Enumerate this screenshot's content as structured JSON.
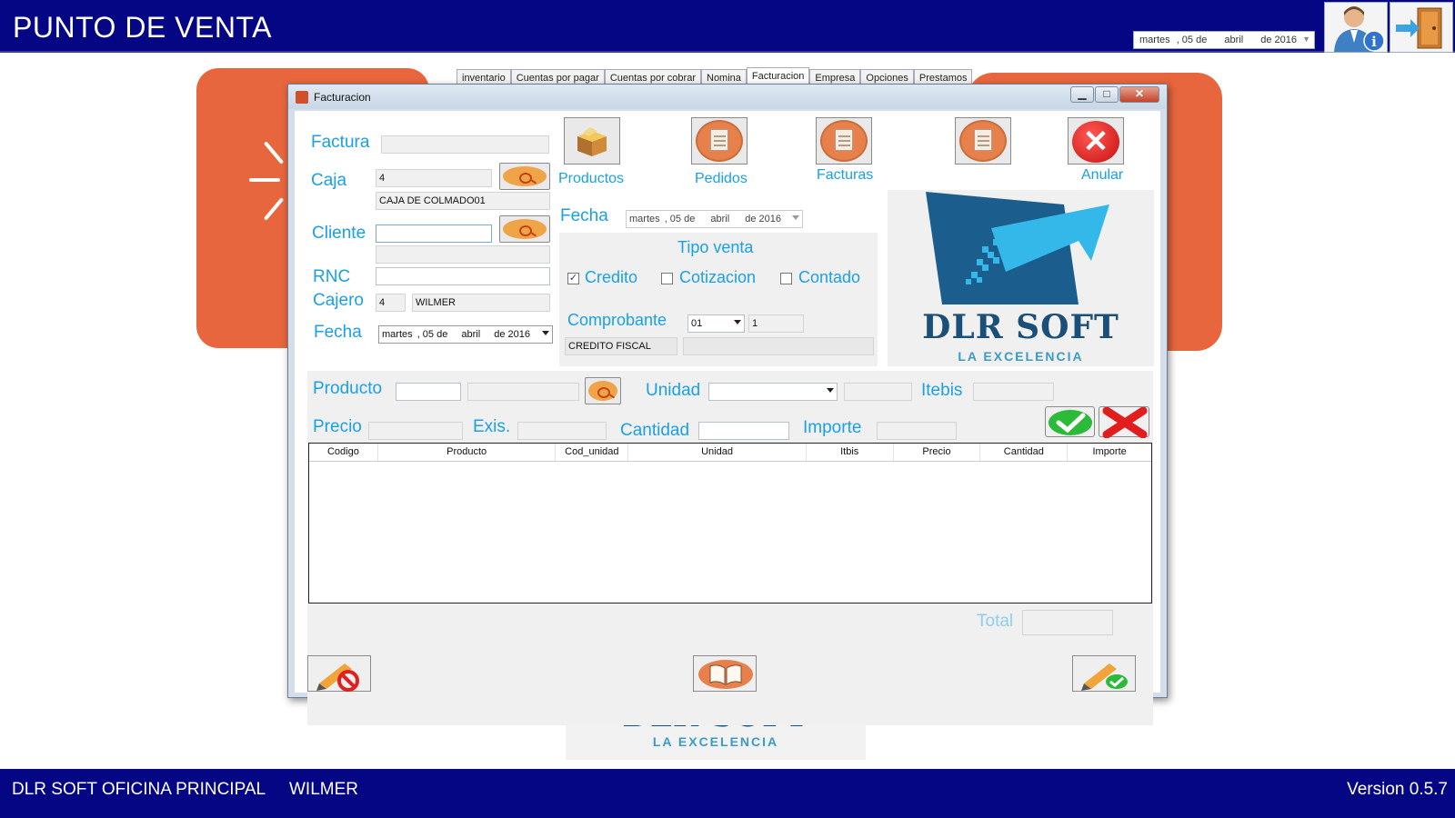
{
  "app": {
    "title": "PUNTO DE VENTA",
    "top_date": {
      "weekday": "martes",
      "day": ", 05 de",
      "month": "abril",
      "year": "de 2016"
    }
  },
  "background": {
    "tabs": [
      "inventario",
      "Cuentas por pagar",
      "Cuentas por cobrar",
      "Nomina",
      "Facturacion",
      "Empresa",
      "Opciones",
      "Prestamos"
    ],
    "active_tab": "Facturacion",
    "logo_name": "DLR SOFT",
    "logo_tagline": "LA EXCELENCIA"
  },
  "statusbar": {
    "office": "DLR SOFT OFICINA PRINCIPAL",
    "user": "WILMER",
    "version": "Version 0.5.7"
  },
  "window": {
    "title": "Facturacion",
    "controls": {
      "minimize": "▁",
      "maximize": "□",
      "close": "✕"
    },
    "form": {
      "factura_label": "Factura",
      "factura_value": "",
      "caja_label": "Caja",
      "caja_id": "4",
      "caja_name": "CAJA DE COLMADO01",
      "cliente_label": "Cliente",
      "cliente_value": "",
      "cliente_name": "",
      "rnc_label": "RNC",
      "rnc_value": "",
      "cajero_label": "Cajero",
      "cajero_id": "4",
      "cajero_name": "WILMER",
      "fecha_label": "Fecha",
      "fecha": {
        "weekday": "martes",
        "day": ", 05 de",
        "month": "abril",
        "year": "de 2016"
      }
    },
    "toolbar": {
      "productos": "Productos",
      "pedidos": "Pedidos",
      "facturas": "Facturas",
      "anular": "Anular"
    },
    "venta": {
      "fecha_label": "Fecha",
      "fecha": {
        "weekday": "martes",
        "day": ", 05 de",
        "month": "abril",
        "year": "de 2016"
      },
      "tipo_label": "Tipo venta",
      "credito_label": "Credito",
      "credito_checked": true,
      "cotizacion_label": "Cotizacion",
      "cotizacion_checked": false,
      "contado_label": "Contado",
      "contado_checked": false,
      "comprobante_label": "Comprobante",
      "comprobante_code": "01",
      "comprobante_seq": "1",
      "comprobante_name": "CREDITO FISCAL",
      "comprobante_extra": ""
    },
    "logo": {
      "name": "DLR SOFT",
      "tagline": "LA EXCELENCIA"
    },
    "product_entry": {
      "producto_label": "Producto",
      "producto_code": "",
      "producto_name": "",
      "unidad_label": "Unidad",
      "unidad_value": "",
      "unidad_extra": "",
      "itebis_label": "Itebis",
      "itebis_value": "",
      "precio_label": "Precio",
      "precio_value": "",
      "exis_label": "Exis.",
      "exis_value": "",
      "cantidad_label": "Cantidad",
      "cantidad_value": "",
      "importe_label": "Importe",
      "importe_value": ""
    },
    "grid": {
      "columns": [
        "Codigo",
        "Producto",
        "Cod_unidad",
        "Unidad",
        "Itbis",
        "Precio",
        "Cantidad",
        "Importe"
      ],
      "rows": []
    },
    "total_label": "Total",
    "total_value": ""
  },
  "colors": {
    "bar_blue": "#050684",
    "label_blue": "#1aa0e6",
    "accent_orange": "#e8663e",
    "logo_dark": "#1a4f7a"
  }
}
